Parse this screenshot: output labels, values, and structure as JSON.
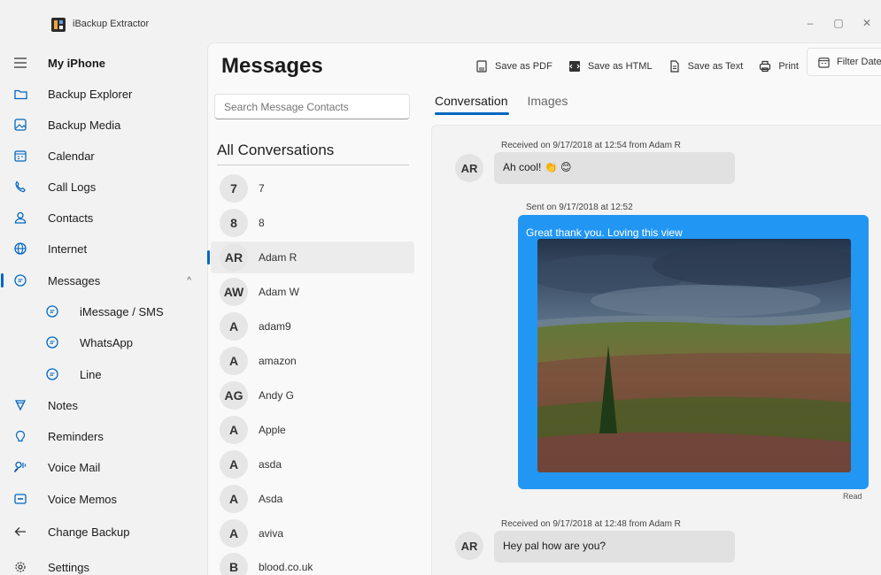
{
  "window": {
    "title": "iBackup Extractor",
    "minimize": "–",
    "maximize": "▢",
    "close": "✕"
  },
  "sidebar": {
    "items": [
      {
        "label": "My iPhone",
        "icon": "hamburger-menu-icon"
      },
      {
        "label": "Backup Explorer",
        "icon": "folder-icon"
      },
      {
        "label": "Backup Media",
        "icon": "image-icon"
      },
      {
        "label": "Calendar",
        "icon": "calendar-icon"
      },
      {
        "label": "Call Logs",
        "icon": "phone-icon"
      },
      {
        "label": "Contacts",
        "icon": "person-icon"
      },
      {
        "label": "Internet",
        "icon": "globe-icon"
      },
      {
        "label": "Messages",
        "icon": "chat-icon",
        "chevron": "^"
      },
      {
        "label": "iMessage / SMS",
        "icon": "chat-icon"
      },
      {
        "label": "WhatsApp",
        "icon": "chat-icon"
      },
      {
        "label": "Line",
        "icon": "chat-icon"
      },
      {
        "label": "Notes",
        "icon": "notes-icon"
      },
      {
        "label": "Reminders",
        "icon": "reminder-icon"
      },
      {
        "label": "Voice Mail",
        "icon": "voicemail-icon"
      },
      {
        "label": "Voice Memos",
        "icon": "voicememo-icon"
      },
      {
        "label": "Change Backup",
        "icon": "arrow-left-icon"
      },
      {
        "label": "Settings",
        "icon": "gear-icon"
      }
    ]
  },
  "main": {
    "title": "Messages",
    "toolbar": {
      "save_pdf": "Save as PDF",
      "save_html": "Save as HTML",
      "save_text": "Save as Text",
      "print": "Print",
      "filter_dates": "Filter Dates"
    },
    "search": {
      "placeholder": "Search Message Contacts"
    },
    "list_header": "All Conversations",
    "contacts": [
      {
        "initials": "7",
        "name": "7"
      },
      {
        "initials": "8",
        "name": "8"
      },
      {
        "initials": "AR",
        "name": "Adam R"
      },
      {
        "initials": "AW",
        "name": "Adam W"
      },
      {
        "initials": "A",
        "name": "adam9"
      },
      {
        "initials": "A",
        "name": "amazon"
      },
      {
        "initials": "AG",
        "name": "Andy G"
      },
      {
        "initials": "A",
        "name": "Apple"
      },
      {
        "initials": "A",
        "name": "asda"
      },
      {
        "initials": "A",
        "name": "Asda"
      },
      {
        "initials": "A",
        "name": "aviva"
      },
      {
        "initials": "B",
        "name": "blood.co.uk"
      }
    ],
    "tabs": [
      {
        "label": "Conversation"
      },
      {
        "label": "Images"
      }
    ],
    "messages": {
      "m1": {
        "meta": "Received on 9/17/2018 at 12:54 from Adam R",
        "avatar": "AR",
        "text": "Ah cool! 👏 😊"
      },
      "m2": {
        "meta": "Sent on 9/17/2018 at 12:52",
        "text": "Great thank you. Loving this view",
        "status": "Read"
      },
      "m3": {
        "meta": "Received on 9/17/2018 at 12:48 from Adam R",
        "avatar": "AR",
        "text": "Hey pal how are you?"
      }
    }
  },
  "colors": {
    "accent": "#0067c0",
    "sent_bubble": "#2196f3",
    "received_bubble": "#e1e1e1"
  }
}
